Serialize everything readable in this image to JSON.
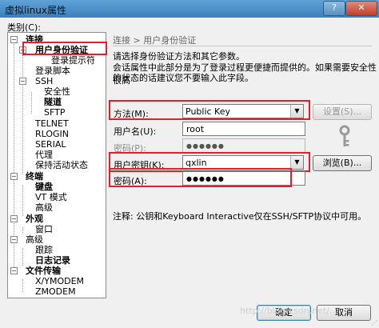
{
  "window": {
    "title": "虚拟linux属性",
    "help_label": "?",
    "close_label": "✕"
  },
  "category_label": "类别(C):",
  "tree": [
    {
      "label": "连接",
      "bold": true
    },
    {
      "label": "用户身份验证",
      "bold": true
    },
    {
      "label": "登录提示符",
      "bold": false
    },
    {
      "label": "登录脚本",
      "bold": false
    },
    {
      "label": "SSH",
      "bold": false
    },
    {
      "label": "安全性",
      "bold": false
    },
    {
      "label": "隧道",
      "bold": true
    },
    {
      "label": "SFTP",
      "bold": false
    },
    {
      "label": "TELNET",
      "bold": false
    },
    {
      "label": "RLOGIN",
      "bold": false
    },
    {
      "label": "SERIAL",
      "bold": false
    },
    {
      "label": "代理",
      "bold": false
    },
    {
      "label": "保持活动状态",
      "bold": false
    },
    {
      "label": "终端",
      "bold": true
    },
    {
      "label": "键盘",
      "bold": true
    },
    {
      "label": "VT 模式",
      "bold": false
    },
    {
      "label": "高级",
      "bold": false
    },
    {
      "label": "外观",
      "bold": true
    },
    {
      "label": "窗口",
      "bold": false
    },
    {
      "label": "高级",
      "bold": false
    },
    {
      "label": "跟踪",
      "bold": false
    },
    {
      "label": "日志记录",
      "bold": true
    },
    {
      "label": "文件传输",
      "bold": true
    },
    {
      "label": "X/YMODEM",
      "bold": false
    },
    {
      "label": "ZMODEM",
      "bold": false
    }
  ],
  "panel": {
    "breadcrumb": "连接 > 用户身份验证",
    "desc_line1": "请选择身份验证方法和其它参数。",
    "desc_line2": "会话属性中此部分是为了登录过程更便捷而提供的。如果需要安全性很高",
    "desc_line3": "的状态的话建议您不要输入此字段。",
    "method_label": "方法(M):",
    "method_value": "Public Key",
    "settings_button": "设置(S)...",
    "username_label": "用户名(U):",
    "username_value": "root",
    "password_label_disabled": "密码(P):",
    "password_value_disabled": "●●●●●●",
    "user_key_label": "用户密钥(K):",
    "user_key_value": "qxlin",
    "browse_button": "浏览(B)...",
    "passphrase_label": "密码(A):",
    "passphrase_value": "●●●●●●",
    "note": "注释: 公钥和Keyboard Interactive仅在SSH/SFTP协议中可用。"
  },
  "buttons": {
    "ok": "确定",
    "cancel": "取消"
  },
  "watermark": "http://blog.csdn.net/..."
}
